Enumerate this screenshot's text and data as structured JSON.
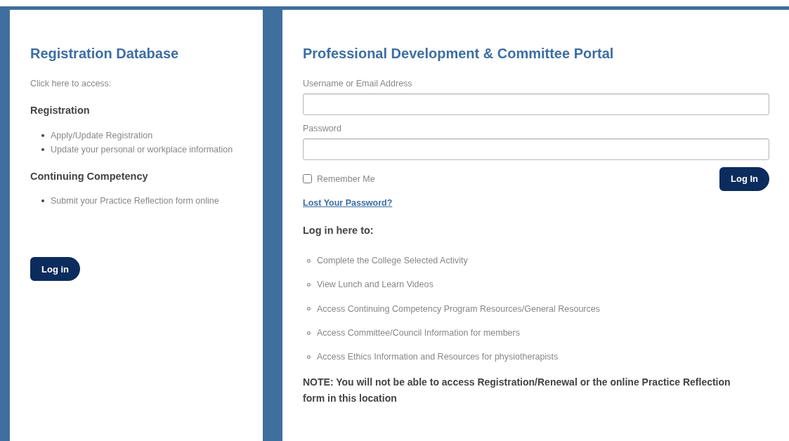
{
  "registration_panel": {
    "title": "Registration Database",
    "intro": "Click here to access:",
    "sections": [
      {
        "heading": "Registration",
        "items": [
          "Apply/Update Registration",
          "Update your personal or workplace information"
        ]
      },
      {
        "heading": "Continuing Competency",
        "items": [
          "Submit your Practice Reflection form online"
        ]
      }
    ],
    "button": "Log in"
  },
  "portal_panel": {
    "title": "Professional Development & Committee Portal",
    "fields": [
      {
        "label": "Username or Email Address"
      },
      {
        "label": "Password"
      }
    ],
    "remember": {
      "label": "Remember Me",
      "checked": false
    },
    "button": "Log In",
    "lost_password": "Lost Your Password?",
    "list_heading": "Log in here to:",
    "items": [
      "Complete the College Selected Activity",
      "View Lunch and Learn Videos",
      "Access Continuing Competency Program Resources/General Resources",
      "Access Committee/Council Information for members",
      "Access Ethics Information and Resources for physiotherapists"
    ],
    "note": "NOTE: You will not be able to access Registration/Renewal or the online Practice Reflection form in this location"
  }
}
